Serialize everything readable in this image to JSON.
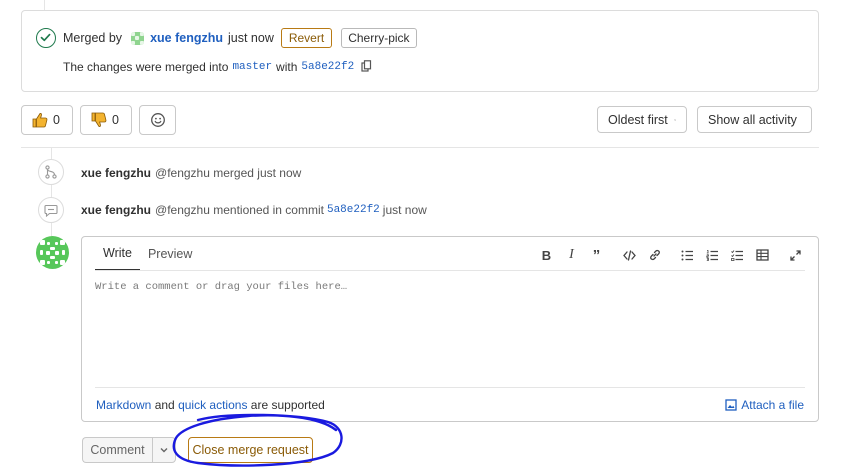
{
  "merged": {
    "prefix": "Merged by",
    "author": "xue fengzhu",
    "time": "just now",
    "revert_label": "Revert",
    "cherry_pick_label": "Cherry-pick",
    "desc_prefix": "The changes were merged into",
    "branch": "master",
    "desc_with": "with",
    "commit": "5a8e22f2"
  },
  "awards": {
    "thumbs_up_count": "0",
    "thumbs_down_count": "0"
  },
  "filters": {
    "sort_label": "Oldest first",
    "activity_label": "Show all activity"
  },
  "notes": [
    {
      "author": "xue fengzhu",
      "handle": "@fengzhu",
      "action": "merged just now"
    },
    {
      "author": "xue fengzhu",
      "handle": "@fengzhu",
      "action": "mentioned in commit",
      "commit": "5a8e22f2",
      "time": "just now"
    }
  ],
  "form": {
    "tab_write": "Write",
    "tab_preview": "Preview",
    "placeholder": "Write a comment or drag your files here…",
    "markdown_link": "Markdown",
    "and_text": "and",
    "quick_actions_link": "quick actions",
    "supported_text": "are supported",
    "attach_label": "Attach a file"
  },
  "actions": {
    "comment_label": "Comment",
    "close_mr_label": "Close merge request"
  },
  "colors": {
    "link": "#1f5fbf",
    "success": "#1f7a4d",
    "warning_border": "#b87a14",
    "annotation": "#1a1adf"
  }
}
